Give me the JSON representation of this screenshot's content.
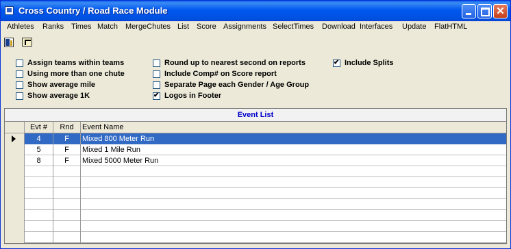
{
  "window": {
    "title": "Cross Country / Road Race Module"
  },
  "menu": [
    "Athletes",
    "Ranks",
    "Times",
    "Match",
    "MergeChutes",
    "List",
    "Score",
    "Assignments",
    "SelectTimes",
    "Download",
    "Interfaces",
    "Update",
    "FlatHTML"
  ],
  "options": {
    "col1": [
      {
        "label": "Assign teams within teams",
        "checked": false
      },
      {
        "label": "Using more than one chute",
        "checked": false
      },
      {
        "label": "Show average mile",
        "checked": false
      },
      {
        "label": "Show average 1K",
        "checked": false
      }
    ],
    "col2": [
      {
        "label": "Round up to nearest second on reports",
        "checked": false
      },
      {
        "label": "Include Comp# on Score report",
        "checked": false
      },
      {
        "label": "Separate Page each Gender / Age Group",
        "checked": false
      },
      {
        "label": "Logos in Footer",
        "checked": true
      }
    ],
    "col3": [
      {
        "label": "Include Splits",
        "checked": true
      }
    ]
  },
  "grid": {
    "caption": "Event List",
    "headers": {
      "evt": "Evt #",
      "rnd": "Rnd",
      "name": "Event Name"
    },
    "rows": [
      {
        "evt": "4",
        "rnd": "F",
        "name": "Mixed 800 Meter Run",
        "selected": true
      },
      {
        "evt": "5",
        "rnd": "F",
        "name": "Mixed 1 Mile Run",
        "selected": false
      },
      {
        "evt": "8",
        "rnd": "F",
        "name": "Mixed 5000 Meter Run",
        "selected": false
      }
    ],
    "empty_rows": 7
  },
  "colors": {
    "titlebar": "#0058ee",
    "selection": "#316ac5",
    "caption": "#0000cc"
  }
}
